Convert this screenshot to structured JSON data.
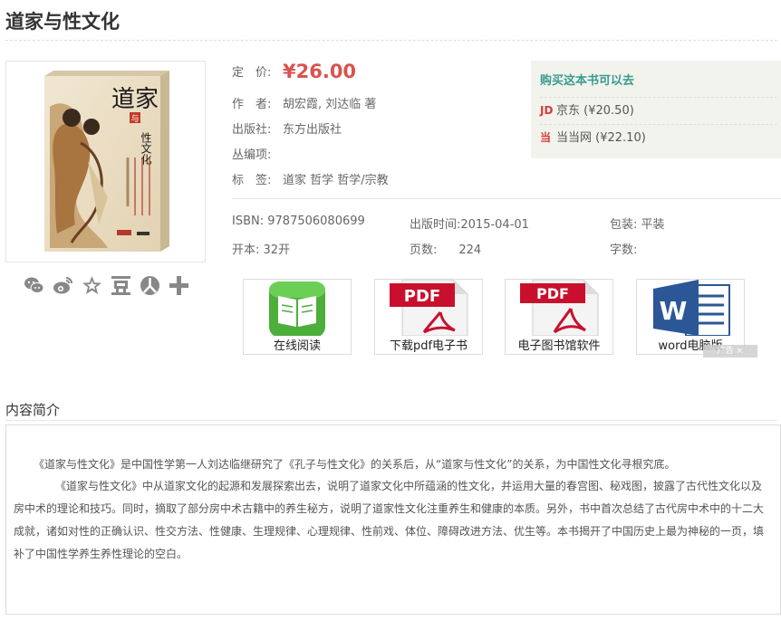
{
  "book": {
    "title": "道家与性文化"
  },
  "info": {
    "price_label": "定　价:",
    "price": "¥26.00",
    "author_label": "作　者:",
    "author": "胡宏霞, 刘达临 著",
    "publisher_label": "出版社:",
    "publisher": "东方出版社",
    "series_label": "丛编项:",
    "series": "",
    "tags_label": "标　签:",
    "tags": "道家 哲学 哲学/宗教"
  },
  "buy": {
    "heading": "购买这本书可以去",
    "stores": [
      {
        "icon": "JD",
        "name": "京东",
        "price": "(¥20.50)"
      },
      {
        "icon": "当",
        "name": "当当网",
        "price": "(¥22.10)"
      }
    ]
  },
  "specs": {
    "isbn_label": "ISBN:",
    "isbn": "9787506080699",
    "pubdate_label": "出版时间:",
    "pubdate": "2015-04-01",
    "binding_label": "包装:",
    "binding": "平装",
    "format_label": "开本:",
    "format": "32开",
    "pages_label": "页数:",
    "pages": "224",
    "words_label": "字数:",
    "words": ""
  },
  "cover_text": {
    "main": "道家",
    "sub": "性文化",
    "mid": "与"
  },
  "share_icons": [
    "wechat-icon",
    "weibo-icon",
    "star-icon",
    "douban-icon",
    "renren-icon",
    "plus-icon"
  ],
  "downloads": [
    {
      "label": "在线阅读",
      "icon": "book-reader-icon"
    },
    {
      "label": "下载pdf电子书",
      "icon": "pdf-icon",
      "badge": "PDF"
    },
    {
      "label": "电子图书馆软件",
      "icon": "pdf-icon",
      "badge": "PDF"
    },
    {
      "label": "word电脑版",
      "icon": "word-icon",
      "badge": "W"
    }
  ],
  "ad_close": "广告 ×",
  "intro": {
    "heading": "内容简介",
    "p1": "《道家与性文化》是中国性学第一人刘达临继研究了《孔子与性文化》的关系后，从“道家与性文化”的关系，为中国性文化寻根究底。",
    "p2": "《道家与性文化》中从道家文化的起源和发展探索出去，说明了道家文化中所蕴涵的性文化，并运用大量的春宫图、秘戏图，披露了古代性文化以及房中术的理论和技巧。同时，摘取了部分房中术古籍中的养生秘方，说明了道家性文化注重养生和健康的本质。另外，书中首次总结了古代房中术中的十二大成就，诸如对性的正确认识、性交方法、性健康、生理规律、心理规律、性前戏、体位、障碍改进方法、优生等。本书揭开了中国历史上最为神秘的一页，填补了中国性学养生养性理论的空白。"
  },
  "colors": {
    "price": "#d9534f",
    "buy_heading": "#3a9b8b",
    "store_icon": "#d93a3a"
  }
}
